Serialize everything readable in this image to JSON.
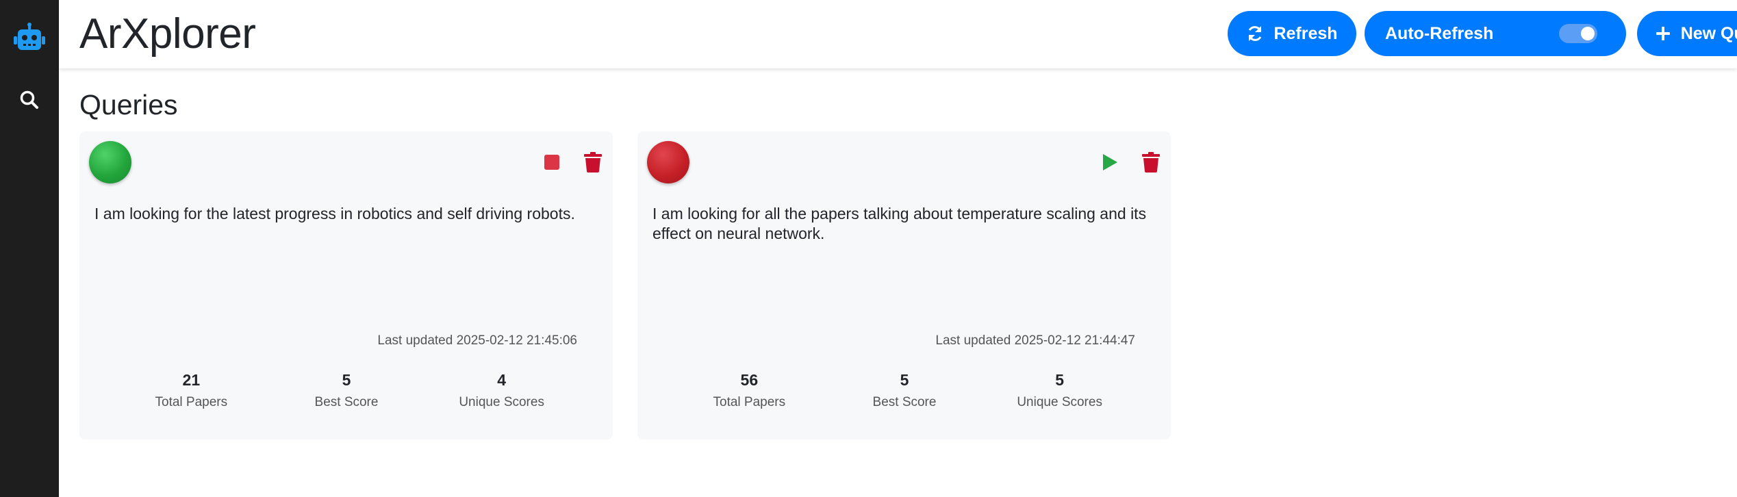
{
  "app": {
    "title": "ArXplorer"
  },
  "header": {
    "refresh_label": "Refresh",
    "auto_refresh_label": "Auto-Refresh",
    "auto_refresh_on": true,
    "new_query_label": "New Query"
  },
  "section": {
    "title": "Queries"
  },
  "queries": [
    {
      "status": "running",
      "status_color": "#23a53c",
      "action_icon": "stop-icon",
      "query": "I am looking for the latest progress in robotics and self driving robots.",
      "last_updated": "Last updated 2025-02-12 21:45:06",
      "stats": [
        {
          "value": "21",
          "label": "Total Papers"
        },
        {
          "value": "5",
          "label": "Best Score"
        },
        {
          "value": "4",
          "label": "Unique Scores"
        }
      ]
    },
    {
      "status": "stopped",
      "status_color": "#c52027",
      "action_icon": "play-icon",
      "query": "I am looking for all the papers talking about temperature scaling and its effect on neural network.",
      "last_updated": "Last updated 2025-02-12 21:44:47",
      "stats": [
        {
          "value": "56",
          "label": "Total Papers"
        },
        {
          "value": "5",
          "label": "Best Score"
        },
        {
          "value": "5",
          "label": "Unique Scores"
        }
      ]
    }
  ],
  "colors": {
    "accent": "#007bff",
    "sidebar": "#1e1e1e",
    "robot": "#1e9bf0",
    "trash": "#c8102e",
    "stop": "#dc3545",
    "play": "#28a745"
  }
}
